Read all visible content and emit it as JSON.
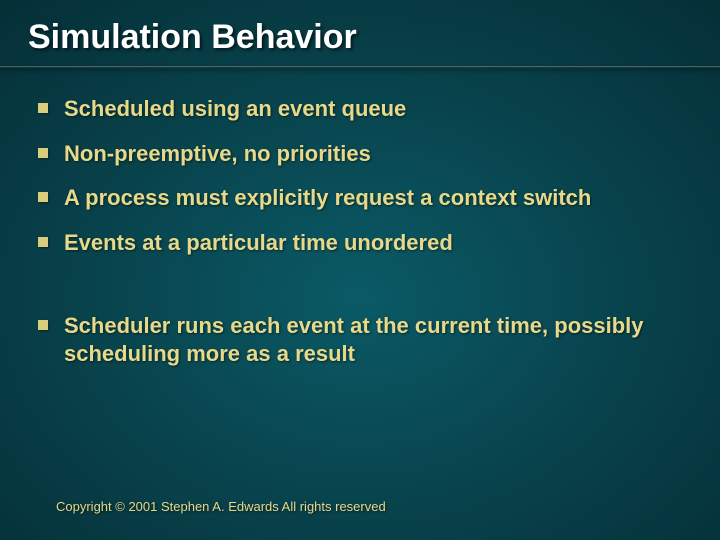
{
  "slide": {
    "title": "Simulation Behavior",
    "bullets": [
      {
        "text": "Scheduled using an event queue"
      },
      {
        "text": "Non-preemptive, no priorities"
      },
      {
        "text": "A process must explicitly request a context switch"
      },
      {
        "text": "Events at a particular time unordered"
      },
      {
        "text": "Scheduler runs each event at the current time, possibly scheduling more as a result"
      }
    ],
    "footer": "Copyright © 2001 Stephen A. Edwards  All rights reserved"
  }
}
